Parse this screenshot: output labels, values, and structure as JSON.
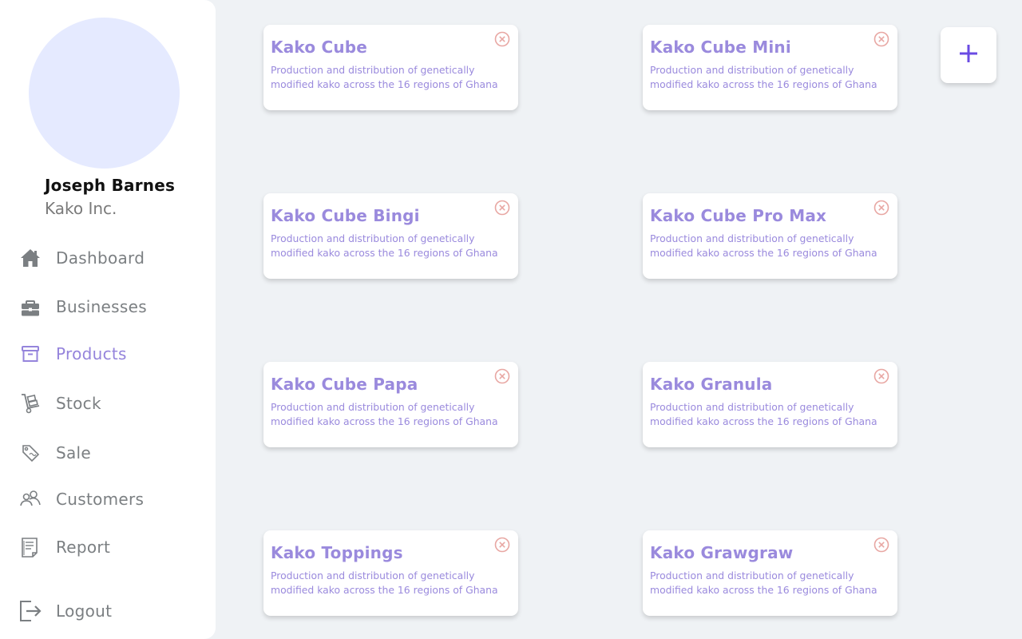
{
  "user": {
    "name": "Joseph Barnes",
    "company": "Kako Inc."
  },
  "nav": {
    "dashboard": "Dashboard",
    "businesses": "Businesses",
    "products": "Products",
    "stock": "Stock",
    "sale": "Sale",
    "customers": "Customers",
    "report": "Report",
    "logout": "Logout",
    "active": "Products"
  },
  "products": [
    {
      "title": "Kako Cube",
      "description": "Production and distribution of genetically modified kako across the 16 regions of Ghana"
    },
    {
      "title": "Kako Cube Mini",
      "description": "Production and distribution of genetically modified kako across the 16 regions of Ghana"
    },
    {
      "title": "Kako Cube Bingi",
      "description": "Production and distribution of genetically modified kako across the 16 regions of Ghana"
    },
    {
      "title": "Kako Cube Pro Max",
      "description": "Production and distribution of genetically modified kako across the 16 regions of Ghana"
    },
    {
      "title": "Kako Cube Papa",
      "description": "Production and distribution of genetically modified kako across the 16 regions of Ghana"
    },
    {
      "title": "Kako Granula",
      "description": "Production and distribution of genetically modified kako across the 16 regions of Ghana"
    },
    {
      "title": "Kako Toppings",
      "description": "Production and distribution of genetically modified kako across the 16 regions of Ghana"
    },
    {
      "title": "Kako Grawgraw",
      "description": "Production and distribution of genetically modified kako across the 16 regions of Ghana"
    }
  ],
  "colors": {
    "accent": "#9a8add",
    "add_button_plus": "#6a4be3",
    "close_icon": "#e8a7a3",
    "nav_icon": "#7b7f82",
    "background": "#eff2f5"
  },
  "icons": {
    "dashboard": "home-icon",
    "businesses": "briefcase-icon",
    "products": "archive-box-icon",
    "stock": "hand-truck-icon",
    "sale": "price-tag-icon",
    "customers": "users-icon",
    "report": "report-icon",
    "logout": "logout-icon",
    "add": "plus-icon",
    "remove": "close-circle-icon"
  }
}
